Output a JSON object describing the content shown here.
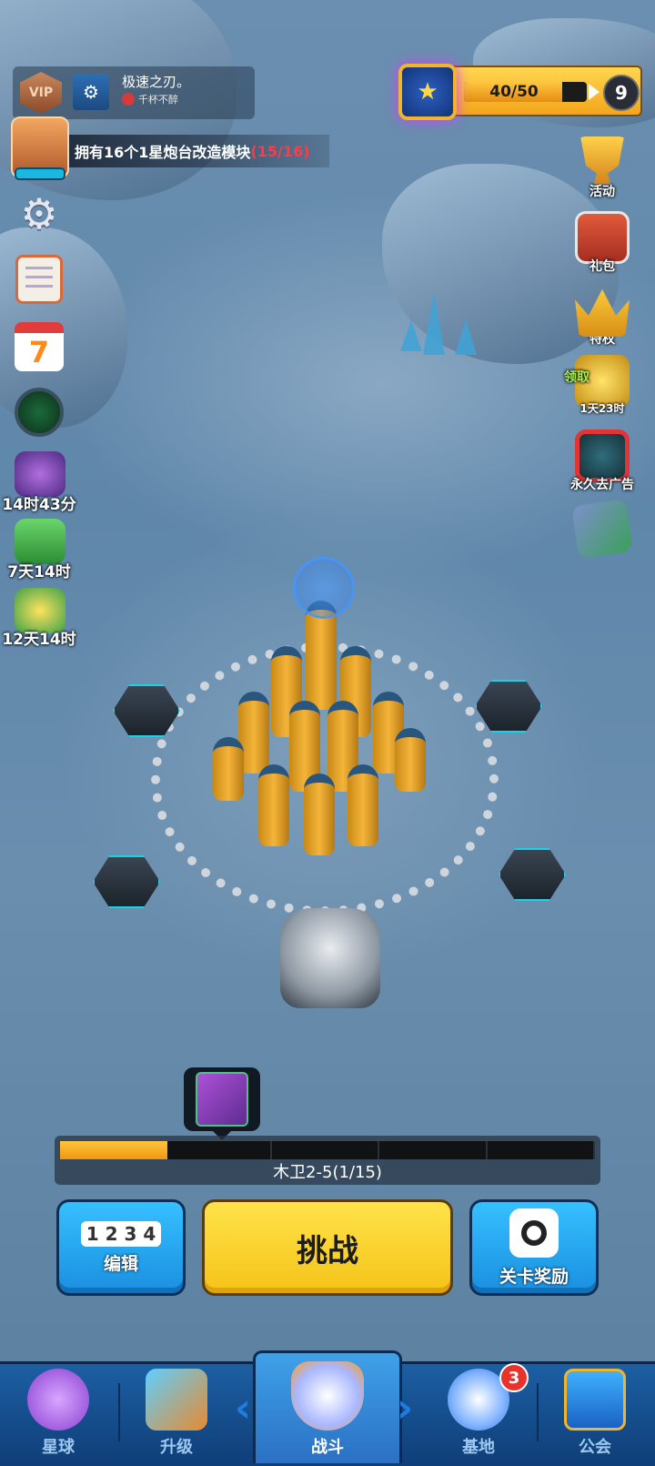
{
  "player": {
    "vip_label": "VIP",
    "name": "极速之刃。",
    "guild": "千杯不醉"
  },
  "quest": {
    "text": "拥有16个1星炮台改造模块",
    "progress": "(15/16)"
  },
  "level": {
    "exp_text": "40/50",
    "exp_fraction": 0.8,
    "level_num": "9"
  },
  "left_menu": {
    "calendar_day": "7",
    "timers": [
      {
        "icon": "monster-event-icon",
        "label": "14时43分"
      },
      {
        "icon": "cash-pack-icon",
        "label": "7天14时"
      },
      {
        "icon": "season-pass-icon",
        "label": "12天14时"
      }
    ]
  },
  "right_menu": {
    "events_label": "活动",
    "gift_label": "礼包",
    "privilege_label": "特权",
    "claim_label": "领取",
    "claim_timer": "1天23时",
    "noads_label": "永久去广告"
  },
  "stage": {
    "label": "木卫2-5(1/15)",
    "segments": 5,
    "progress_fraction": 0.2
  },
  "actions": {
    "edit_label": "编辑",
    "edit_icon_text": "1 2 3 4",
    "challenge_label": "挑战",
    "rewards_label": "关卡奖励"
  },
  "nav": {
    "items": [
      "星球",
      "升级",
      "战斗",
      "基地",
      "公会"
    ],
    "active": "战斗",
    "base_badge": "3"
  },
  "colors": {
    "accent_yellow": "#f5c318",
    "accent_blue": "#1a8fe0",
    "quest_progress_red": "#ff3b48"
  }
}
